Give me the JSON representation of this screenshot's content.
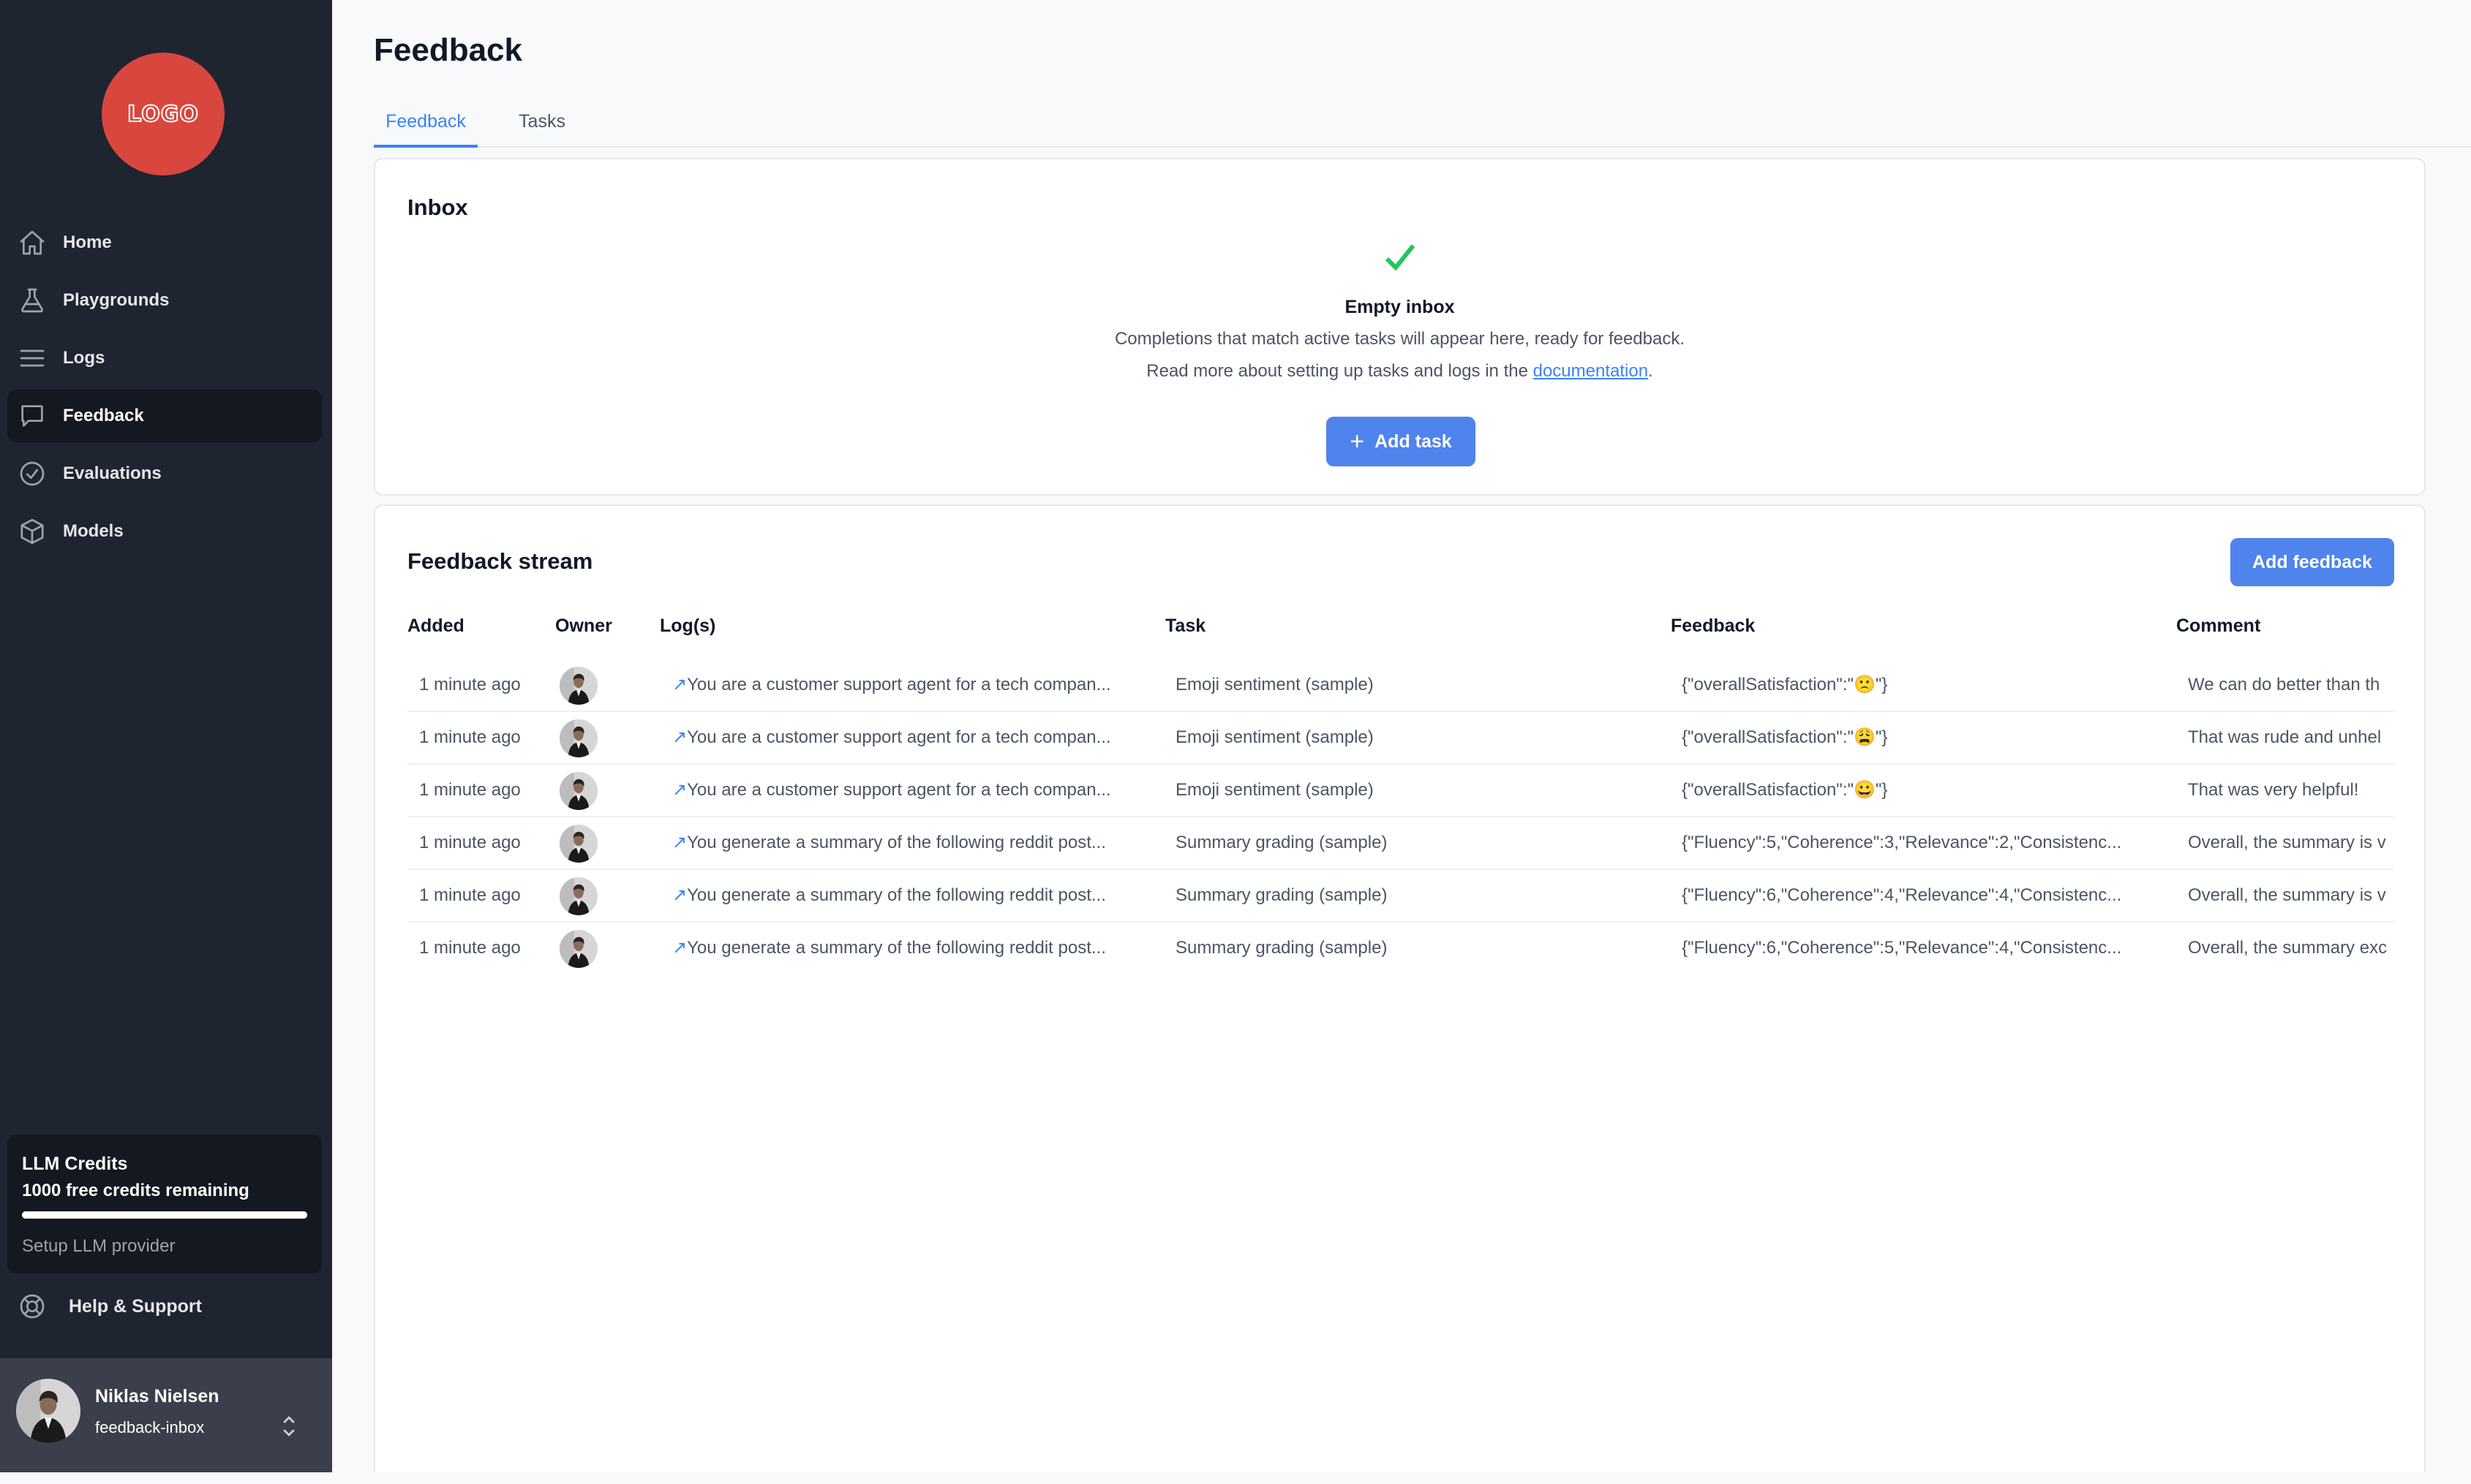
{
  "sidebar": {
    "logo_text": "LOGO",
    "items": [
      {
        "label": "Home",
        "icon": "home-icon"
      },
      {
        "label": "Playgrounds",
        "icon": "flask-icon"
      },
      {
        "label": "Logs",
        "icon": "list-icon"
      },
      {
        "label": "Feedback",
        "icon": "chat-icon",
        "active": true
      },
      {
        "label": "Evaluations",
        "icon": "check-circle-icon"
      },
      {
        "label": "Models",
        "icon": "cube-icon"
      }
    ],
    "credits": {
      "title": "LLM Credits",
      "remaining": "1000 free credits remaining",
      "progress": 1.0,
      "setup_label": "Setup LLM provider"
    },
    "help_label": "Help & Support",
    "user": {
      "name": "Niklas Nielsen",
      "org": "feedback-inbox"
    }
  },
  "page": {
    "title": "Feedback",
    "tabs": [
      {
        "label": "Feedback",
        "active": true
      },
      {
        "label": "Tasks",
        "active": false
      }
    ]
  },
  "inbox": {
    "title": "Inbox",
    "empty_title": "Empty inbox",
    "desc1": "Completions that match active tasks will appear here, ready for feedback.",
    "desc2_prefix": "Read more about setting up tasks and logs in the ",
    "desc2_link": "documentation",
    "desc2_suffix": ".",
    "add_task_label": "Add task"
  },
  "stream": {
    "title": "Feedback stream",
    "add_feedback_label": "Add feedback",
    "columns": [
      "Added",
      "Owner",
      "Log(s)",
      "Task",
      "Feedback",
      "Comment"
    ],
    "rows": [
      {
        "added": "1 minute ago",
        "log": "You are a customer support agent for a tech compan...",
        "task": "Emoji sentiment (sample)",
        "feedback": "{\"overallSatisfaction\":\"🙁\"}",
        "comment": "We can do better than th"
      },
      {
        "added": "1 minute ago",
        "log": "You are a customer support agent for a tech compan...",
        "task": "Emoji sentiment (sample)",
        "feedback": "{\"overallSatisfaction\":\"😩\"}",
        "comment": "That was rude and unhel"
      },
      {
        "added": "1 minute ago",
        "log": "You are a customer support agent for a tech compan...",
        "task": "Emoji sentiment (sample)",
        "feedback": "{\"overallSatisfaction\":\"😀\"}",
        "comment": "That was very helpful!"
      },
      {
        "added": "1 minute ago",
        "log": "You generate a summary of the following reddit post...",
        "task": "Summary grading (sample)",
        "feedback": "{\"Fluency\":5,\"Coherence\":3,\"Relevance\":2,\"Consistenc...",
        "comment": "Overall, the summary is v"
      },
      {
        "added": "1 minute ago",
        "log": "You generate a summary of the following reddit post...",
        "task": "Summary grading (sample)",
        "feedback": "{\"Fluency\":6,\"Coherence\":4,\"Relevance\":4,\"Consistenc...",
        "comment": "Overall, the summary is v"
      },
      {
        "added": "1 minute ago",
        "log": "You generate a summary of the following reddit post...",
        "task": "Summary grading (sample)",
        "feedback": "{\"Fluency\":6,\"Coherence\":5,\"Relevance\":4,\"Consistenc...",
        "comment": "Overall, the summary exc"
      }
    ]
  },
  "colors": {
    "sidebar_bg": "#1f2431",
    "accent": "#4f84ec",
    "logo": "#d9463e",
    "success": "#22c55e"
  }
}
